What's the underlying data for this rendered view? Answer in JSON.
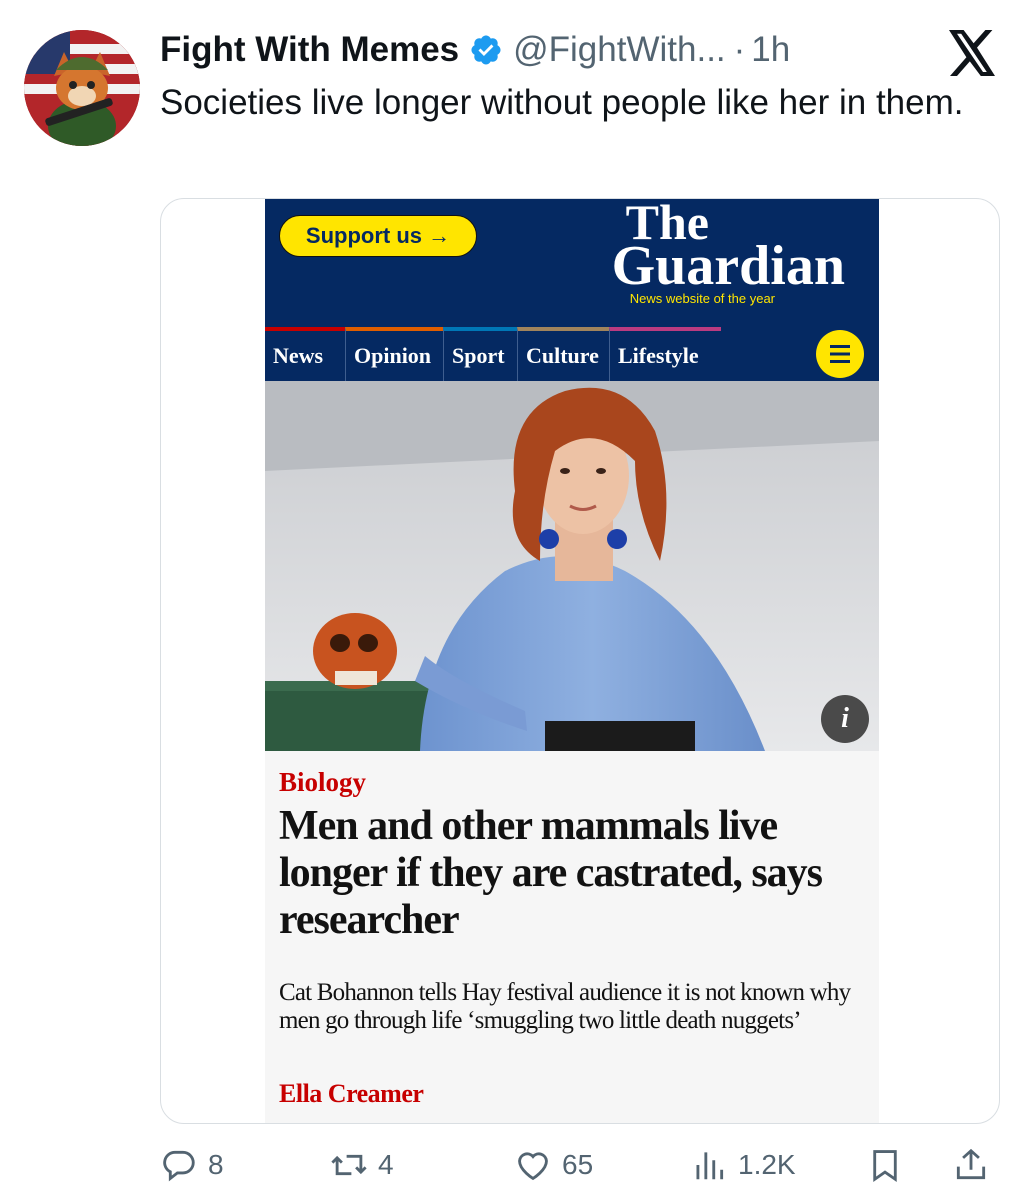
{
  "tweet": {
    "author_name": "Fight With Memes",
    "handle": "@FightWith...",
    "separator": "·",
    "time": "1h",
    "text": "Societies live longer without people like her in them.",
    "avatar_icon": "cartoon-soldier-fox-avatar",
    "verified_icon": "verified-badge-icon",
    "platform_icon": "x-logo-icon"
  },
  "article": {
    "support_label": "Support us →",
    "logo_the": "The",
    "logo_guardian": "Guardian",
    "logo_tagline": "News website of the year",
    "nav": [
      {
        "label": "News",
        "color": "#c70000"
      },
      {
        "label": "Opinion",
        "color": "#e05e00"
      },
      {
        "label": "Sport",
        "color": "#0077b6"
      },
      {
        "label": "Culture",
        "color": "#a1845c"
      },
      {
        "label": "Lifestyle",
        "color": "#bb3b80"
      }
    ],
    "menu_icon": "hamburger-menu-icon",
    "info_label": "i",
    "kicker": "Biology",
    "headline": "Men and other mammals live longer if they are castrated, says researcher",
    "standfirst": "Cat Bohannon tells Hay festival audience it is not known why men go through life ‘smuggling two little death nuggets’",
    "byline": "Ella Creamer"
  },
  "actions": {
    "replies": "8",
    "retweets": "4",
    "likes": "65",
    "views": "1.2K"
  },
  "colors": {
    "guardian_blue": "#052962",
    "guardian_yellow": "#ffe500",
    "guardian_red": "#c70000",
    "twitter_blue": "#1d9bf0",
    "muted": "#536471"
  }
}
